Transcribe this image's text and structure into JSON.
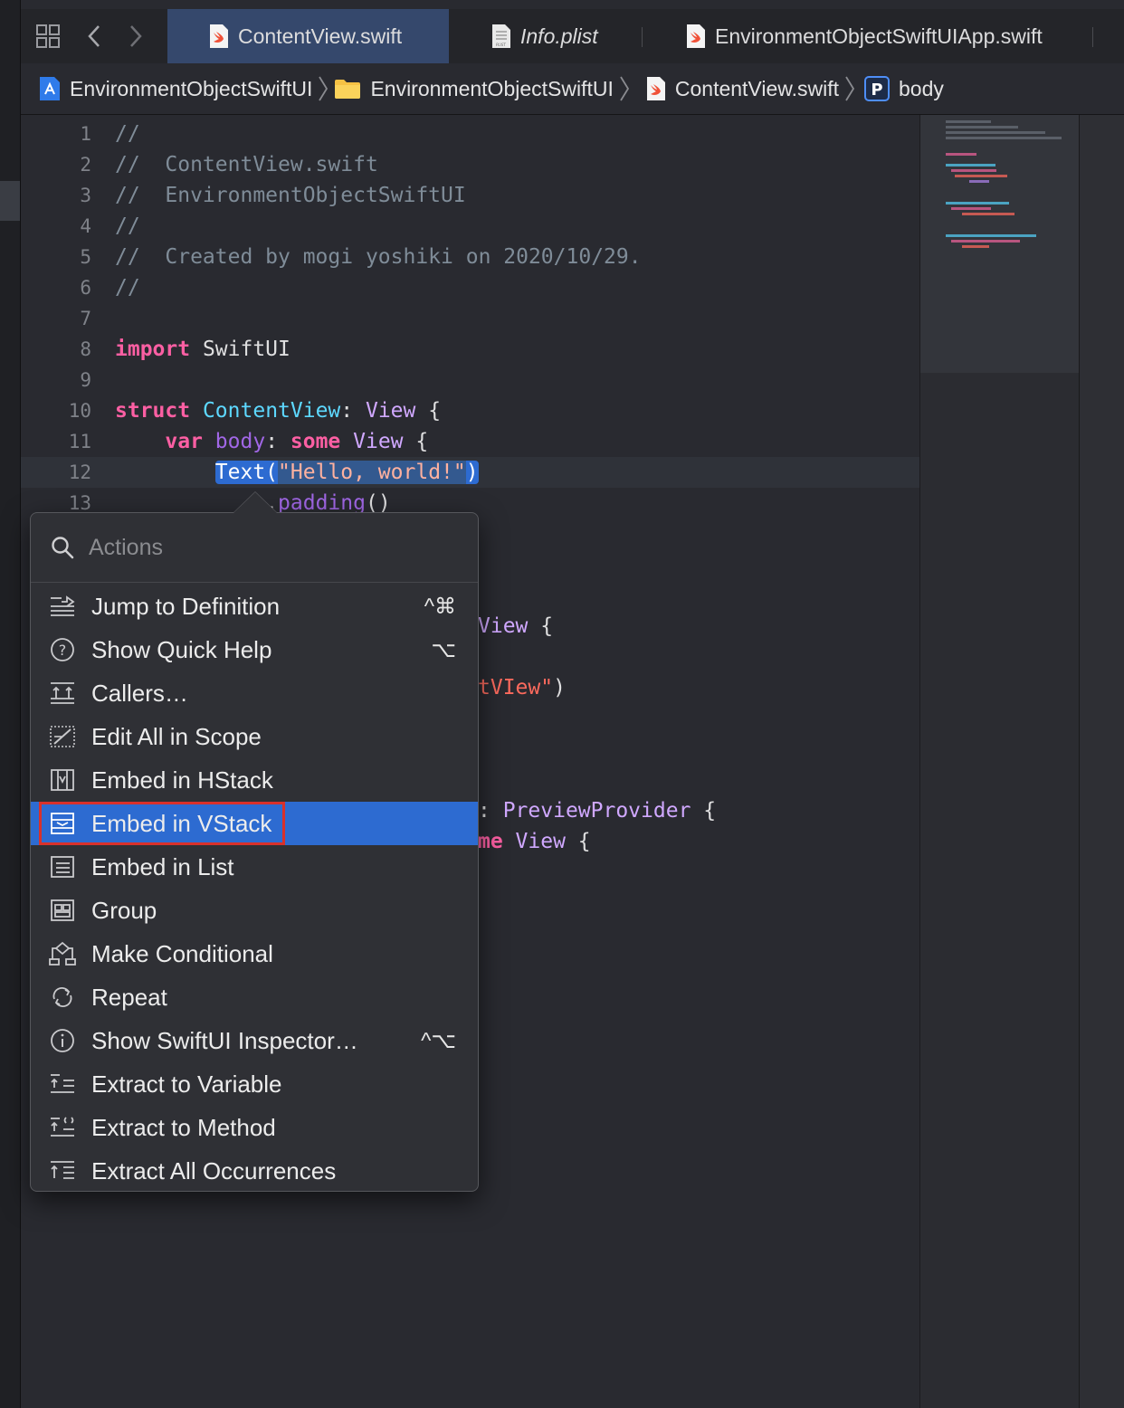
{
  "tabs": [
    {
      "label": "ContentView.swift",
      "icon": "swift-file-icon",
      "active": true
    },
    {
      "label": "Info.plist",
      "icon": "plist-file-icon",
      "active": false
    },
    {
      "label": "EnvironmentObjectSwiftUIApp.swift",
      "icon": "swift-file-icon",
      "active": false
    }
  ],
  "breadcrumb": [
    {
      "label": "EnvironmentObjectSwiftUI",
      "icon": "project-icon"
    },
    {
      "label": "EnvironmentObjectSwiftUI",
      "icon": "folder-icon"
    },
    {
      "label": "ContentView.swift",
      "icon": "swift-file-icon"
    },
    {
      "label": "body",
      "icon": "property-icon",
      "icon_letter": "P"
    }
  ],
  "line_numbers": [
    "1",
    "2",
    "3",
    "4",
    "5",
    "6",
    "7",
    "8",
    "9",
    "10",
    "11",
    "12",
    "13"
  ],
  "code": {
    "l1": "//",
    "l2": "//  ContentView.swift",
    "l3": "//  EnvironmentObjectSwiftUI",
    "l4": "//",
    "l5": "//  Created by mogi yoshiki on 2020/10/29.",
    "l6": "//",
    "l8_kw": "import",
    "l8_rest": " SwiftUI",
    "l10_kw": "struct",
    "l10_name": "ContentView",
    "l10_colon": ": ",
    "l10_type": "View",
    "l10_brace": " {",
    "l11_kw": "var",
    "l11_prop": "body",
    "l11_colon": ": ",
    "l11_some": "some",
    "l11_type": "View",
    "l11_brace": " {",
    "l12_call": "Text(",
    "l12_str": "\"Hello, world!\"",
    "l12_close": ")",
    "l13_dot": ".",
    "l13_method": "padding",
    "l13_parens": "()",
    "frag_view1": "View",
    "frag_view1_brace": " {",
    "frag_str": "tVIew\"",
    "frag_paren": ")",
    "frag_colon": ": ",
    "frag_preview": "PreviewProvider",
    "frag_preview_brace": " {",
    "frag_me": "me",
    "frag_view2": " View",
    "frag_view2_brace": " {"
  },
  "actions_menu": {
    "search_placeholder": "Actions",
    "items": [
      {
        "label": "Jump to Definition",
        "icon": "jump-to-definition-icon",
        "shortcut": "^⌘"
      },
      {
        "label": "Show Quick Help",
        "icon": "quick-help-icon",
        "shortcut": "⌥"
      },
      {
        "label": "Callers…",
        "icon": "callers-icon",
        "shortcut": ""
      },
      {
        "label": "Edit All in Scope",
        "icon": "edit-all-in-scope-icon",
        "shortcut": ""
      },
      {
        "label": "Embed in HStack",
        "icon": "embed-hstack-icon",
        "shortcut": ""
      },
      {
        "label": "Embed in VStack",
        "icon": "embed-vstack-icon",
        "shortcut": "",
        "highlighted": true
      },
      {
        "label": "Embed in List",
        "icon": "embed-list-icon",
        "shortcut": ""
      },
      {
        "label": "Group",
        "icon": "group-icon",
        "shortcut": ""
      },
      {
        "label": "Make Conditional",
        "icon": "make-conditional-icon",
        "shortcut": ""
      },
      {
        "label": "Repeat",
        "icon": "repeat-icon",
        "shortcut": ""
      },
      {
        "label": "Show SwiftUI Inspector…",
        "icon": "info-icon",
        "shortcut": "^⌥"
      },
      {
        "label": "Extract to Variable",
        "icon": "extract-variable-icon",
        "shortcut": ""
      },
      {
        "label": "Extract to Method",
        "icon": "extract-method-icon",
        "shortcut": ""
      },
      {
        "label": "Extract All Occurrences",
        "icon": "extract-all-icon",
        "shortcut": ""
      }
    ]
  },
  "colors": {
    "accent": "#2d6bd1",
    "active_tab": "#35486c",
    "keyword": "#fc5fa3",
    "type": "#d0a8ff",
    "declared_type": "#5dd8ff",
    "string": "#fc6a5d",
    "comment": "#7f8c98",
    "annotation_box": "#d9312b"
  }
}
